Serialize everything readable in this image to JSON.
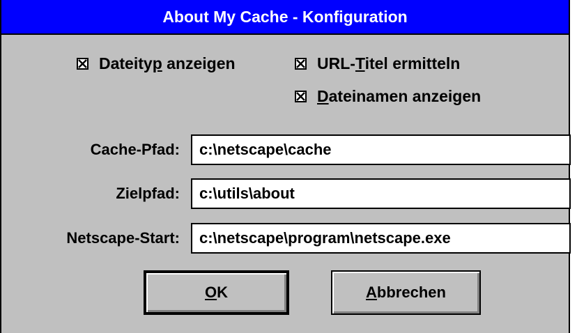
{
  "window": {
    "title": "About My Cache - Konfiguration"
  },
  "checkboxes": [
    {
      "pre": "Dateity",
      "u": "p",
      "post": " anzeigen",
      "checked": true
    },
    {
      "pre": "URL-",
      "u": "T",
      "post": "itel ermitteln",
      "checked": true
    },
    {
      "pre": "",
      "u": "D",
      "post": "ateinamen anzeigen",
      "checked": true
    }
  ],
  "fields": {
    "cache_path": {
      "label": "Cache-Pfad:",
      "value": "c:\\netscape\\cache"
    },
    "target_path": {
      "label": "Zielpfad:",
      "value": "c:\\utils\\about"
    },
    "netscape_start": {
      "label": "Netscape-Start:",
      "value": "c:\\netscape\\program\\netscape.exe"
    }
  },
  "buttons": {
    "ok": {
      "u": "O",
      "rest": "K"
    },
    "cancel": {
      "u": "A",
      "rest": "bbrechen"
    }
  },
  "colors": {
    "titlebar": "#0000ff",
    "dialog": "#c0c0c0"
  }
}
